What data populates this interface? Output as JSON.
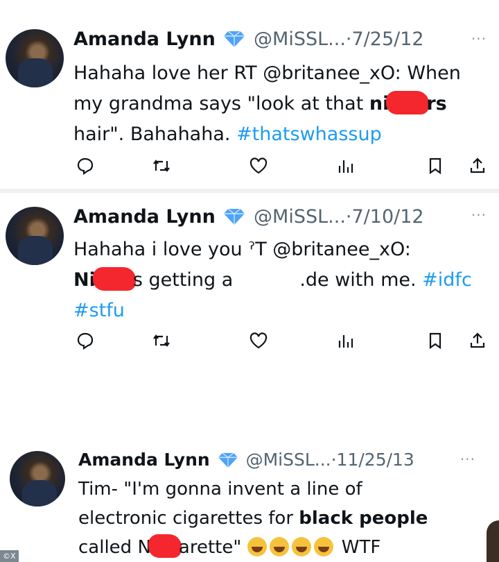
{
  "tweets": [
    {
      "name": "Amanda Lynn",
      "handle": "@MiSSL...",
      "date": "·7/25/12",
      "more": "···",
      "lines": {
        "l1": "Hahaha love her RT @britanee_xO: When",
        "l2a": "my grandma says \"look at that ",
        "l2b": "ni",
        "l2c": "rs",
        "l3a": "hair\". Bahahaha. ",
        "l3b": "#thatswhassup"
      }
    },
    {
      "name": "Amanda Lynn",
      "handle": "@MiSSL...",
      "date": "·7/10/12",
      "more": "···",
      "lines": {
        "l1": "Hahaha i love you ˀT @britanee_xO:",
        "l2a": "Ni",
        "l2b": "s getting a",
        "l2c": ".de with me. ",
        "l2d": "#idfc",
        "l3": "#stfu"
      }
    },
    {
      "name": "Amanda Lynn",
      "handle": "@MiSSL...",
      "date": "·11/25/13",
      "more": "···",
      "lines": {
        "l1": "Tim- \"I'm gonna invent a line of",
        "l2a": "electronic cigarettes for ",
        "l2b": "black people",
        "l3a": "called N",
        "l3b": "arette\" ",
        "l3c": " WTF"
      }
    }
  ],
  "icons": [
    "reply-icon",
    "retweet-icon",
    "like-icon",
    "views-icon",
    "bookmark-icon",
    "share-icon"
  ],
  "colors": {
    "link": "#1d9bf0",
    "verified": "#4fa3f7",
    "muted": "#536471",
    "redaction": "#f4262e"
  },
  "watermark": "©X"
}
